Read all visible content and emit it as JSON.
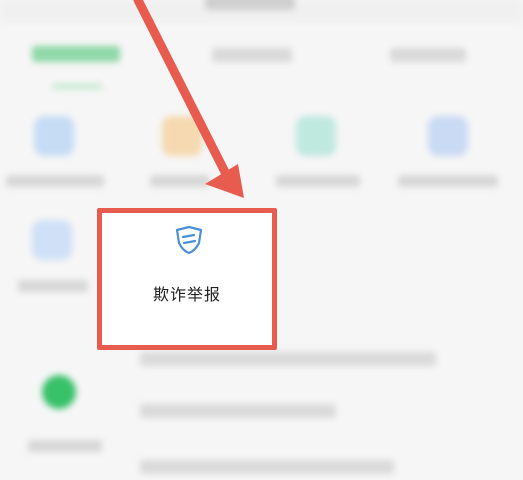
{
  "report_item": {
    "label": "欺诈举报",
    "icon": "shield-icon"
  },
  "colors": {
    "highlight": "#e85b4f",
    "accent_green": "#39c16a",
    "icon_blue": "#4a90d9",
    "background": "#f6f6f6"
  }
}
